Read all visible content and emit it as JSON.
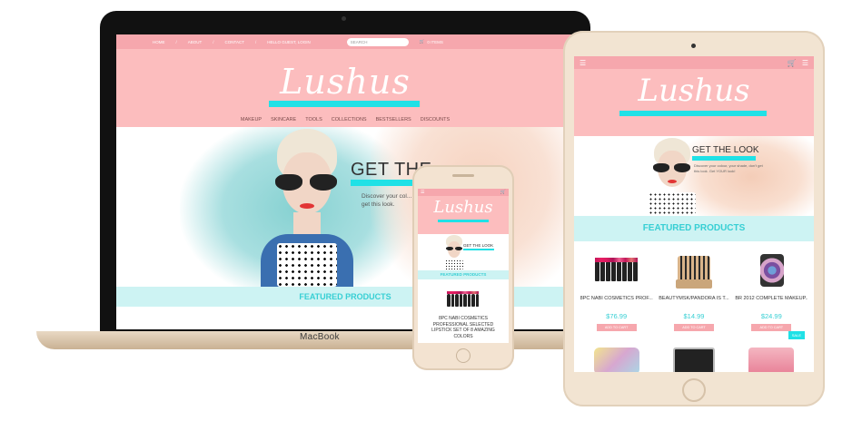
{
  "laptop": {
    "brand": "MacBook",
    "topbar": {
      "links": [
        "HOME",
        "ABOUT",
        "CONTACT"
      ],
      "greeting": "HELLO GUEST, LOGIN",
      "search_placeholder": "Search",
      "cart": "0 Items"
    },
    "logo": "Lushus",
    "nav": [
      "MAKEUP",
      "SKINCARE",
      "TOOLS",
      "COLLECTIONS",
      "BESTSELLERS",
      "DISCOUNTS"
    ],
    "hero": {
      "title": "GET THE",
      "desc": "Discover your col... don't get this look."
    },
    "featured": "FEATURED PRODUCTS"
  },
  "tablet": {
    "logo": "Lushus",
    "hero": {
      "title": "GET THE LOOK",
      "desc": "Discover your colour, your shade, don't get this look. Get YOUR look!"
    },
    "featured": "FEATURED PRODUCTS",
    "products": [
      {
        "name": "8PC NABI COSMETICS PROF...",
        "price": "$76.99",
        "button": "ADD TO CART"
      },
      {
        "name": "BEAUTYMSK/PANDORA IS T...",
        "price": "$14.99",
        "button": "ADD TO CART"
      },
      {
        "name": "BR 2012 COMPLETE MAKEUP...",
        "price": "$24.99",
        "button": "ADD TO CART"
      }
    ],
    "sale_badge": "SALE"
  },
  "phone": {
    "logo": "Lushus",
    "hero": {
      "title": "GET THE LOOK"
    },
    "featured": "FEATURED PRODUCTS",
    "product_name": "8PC NABI COSMETICS PROFESSIONAL SELECTED LIPSTICK SET OF 8 AMAZING COLORS"
  },
  "colors": {
    "pink_bar": "#f6a7ad",
    "pink_header": "#fcbdbe",
    "accent_cyan": "#20e1e6",
    "featured_bg": "#cdf3f3"
  }
}
